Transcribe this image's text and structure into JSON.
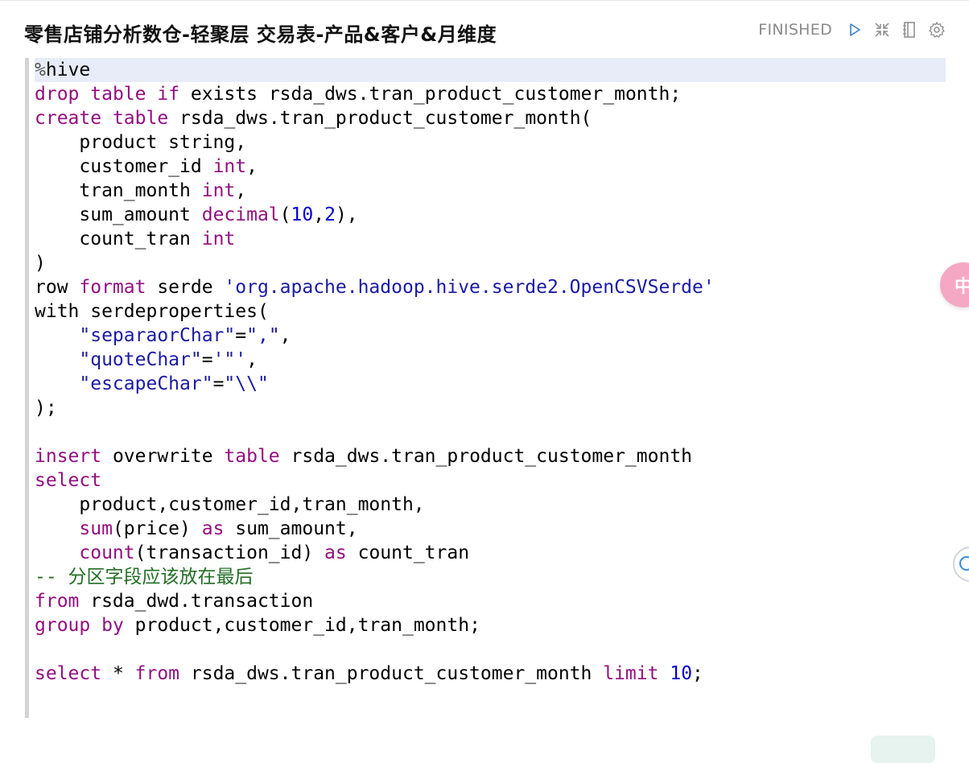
{
  "paragraph": {
    "title": "零售店铺分析数仓-轻聚层 交易表-产品&客户&月维度",
    "status": "FINISHED",
    "icons": [
      "play-icon",
      "collapse-icon",
      "book-icon",
      "gear-icon"
    ]
  },
  "side_badge": {
    "text": "中"
  },
  "colors": {
    "keyword": "#930f80",
    "number": "#0000cd",
    "string": "#1a1aa6",
    "comment": "#236e25",
    "active_line": "#e8ecf8"
  },
  "code": {
    "lines": [
      [
        {
          "t": "%",
          "c": "pct"
        },
        {
          "t": "hive",
          "c": ""
        }
      ],
      [
        {
          "t": "drop",
          "c": "kw"
        },
        {
          "t": " ",
          "c": ""
        },
        {
          "t": "table",
          "c": "kw"
        },
        {
          "t": " ",
          "c": ""
        },
        {
          "t": "if",
          "c": "kw"
        },
        {
          "t": " exists rsda_dws.tran_product_customer_month;",
          "c": ""
        }
      ],
      [
        {
          "t": "create",
          "c": "kw"
        },
        {
          "t": " ",
          "c": ""
        },
        {
          "t": "table",
          "c": "kw"
        },
        {
          "t": " rsda_dws.tran_product_customer_month(",
          "c": ""
        }
      ],
      [
        {
          "t": "    product string,",
          "c": ""
        }
      ],
      [
        {
          "t": "    customer_id ",
          "c": ""
        },
        {
          "t": "int",
          "c": "ty"
        },
        {
          "t": ",",
          "c": ""
        }
      ],
      [
        {
          "t": "    tran_month ",
          "c": ""
        },
        {
          "t": "int",
          "c": "ty"
        },
        {
          "t": ",",
          "c": ""
        }
      ],
      [
        {
          "t": "    sum_amount ",
          "c": ""
        },
        {
          "t": "decimal",
          "c": "ty"
        },
        {
          "t": "(",
          "c": ""
        },
        {
          "t": "10",
          "c": "num"
        },
        {
          "t": ",",
          "c": ""
        },
        {
          "t": "2",
          "c": "num"
        },
        {
          "t": "),",
          "c": ""
        }
      ],
      [
        {
          "t": "    count_tran ",
          "c": ""
        },
        {
          "t": "int",
          "c": "ty"
        }
      ],
      [
        {
          "t": ")",
          "c": ""
        }
      ],
      [
        {
          "t": "row ",
          "c": ""
        },
        {
          "t": "format",
          "c": "kw"
        },
        {
          "t": " serde ",
          "c": ""
        },
        {
          "t": "'org.apache.hadoop.hive.serde2.OpenCSVSerde'",
          "c": "str"
        }
      ],
      [
        {
          "t": "with serdeproperties(",
          "c": ""
        }
      ],
      [
        {
          "t": "    ",
          "c": ""
        },
        {
          "t": "\"separaorChar\"",
          "c": "str"
        },
        {
          "t": "=",
          "c": ""
        },
        {
          "t": "\",\"",
          "c": "str"
        },
        {
          "t": ",",
          "c": ""
        }
      ],
      [
        {
          "t": "    ",
          "c": ""
        },
        {
          "t": "\"quoteChar\"",
          "c": "str"
        },
        {
          "t": "=",
          "c": ""
        },
        {
          "t": "'\"'",
          "c": "str"
        },
        {
          "t": ",",
          "c": ""
        }
      ],
      [
        {
          "t": "    ",
          "c": ""
        },
        {
          "t": "\"escapeChar\"",
          "c": "str"
        },
        {
          "t": "=",
          "c": ""
        },
        {
          "t": "\"\\\\\"",
          "c": "str"
        }
      ],
      [
        {
          "t": ");",
          "c": ""
        }
      ],
      [
        {
          "t": " ",
          "c": ""
        }
      ],
      [
        {
          "t": "insert",
          "c": "kw"
        },
        {
          "t": " overwrite ",
          "c": ""
        },
        {
          "t": "table",
          "c": "kw"
        },
        {
          "t": " rsda_dws.tran_product_customer_month",
          "c": ""
        }
      ],
      [
        {
          "t": "select",
          "c": "kw"
        }
      ],
      [
        {
          "t": "    product,customer_id,tran_month,",
          "c": ""
        }
      ],
      [
        {
          "t": "    ",
          "c": ""
        },
        {
          "t": "sum",
          "c": "fn"
        },
        {
          "t": "(price) ",
          "c": ""
        },
        {
          "t": "as",
          "c": "kw"
        },
        {
          "t": " sum_amount,",
          "c": ""
        }
      ],
      [
        {
          "t": "    ",
          "c": ""
        },
        {
          "t": "count",
          "c": "fn"
        },
        {
          "t": "(transaction_id) ",
          "c": ""
        },
        {
          "t": "as",
          "c": "kw"
        },
        {
          "t": " count_tran",
          "c": ""
        }
      ],
      [
        {
          "t": "-- 分区字段应该放在最后",
          "c": "cm"
        }
      ],
      [
        {
          "t": "from",
          "c": "kw"
        },
        {
          "t": " rsda_dwd.transaction",
          "c": ""
        }
      ],
      [
        {
          "t": "group",
          "c": "kw"
        },
        {
          "t": " ",
          "c": ""
        },
        {
          "t": "by",
          "c": "kw"
        },
        {
          "t": " product,customer_id,tran_month;",
          "c": ""
        }
      ],
      [
        {
          "t": " ",
          "c": ""
        }
      ],
      [
        {
          "t": "select",
          "c": "kw"
        },
        {
          "t": " * ",
          "c": ""
        },
        {
          "t": "from",
          "c": "kw"
        },
        {
          "t": " rsda_dws.tran_product_customer_month ",
          "c": ""
        },
        {
          "t": "limit",
          "c": "kw"
        },
        {
          "t": " ",
          "c": ""
        },
        {
          "t": "10",
          "c": "num"
        },
        {
          "t": ";",
          "c": ""
        }
      ]
    ]
  }
}
